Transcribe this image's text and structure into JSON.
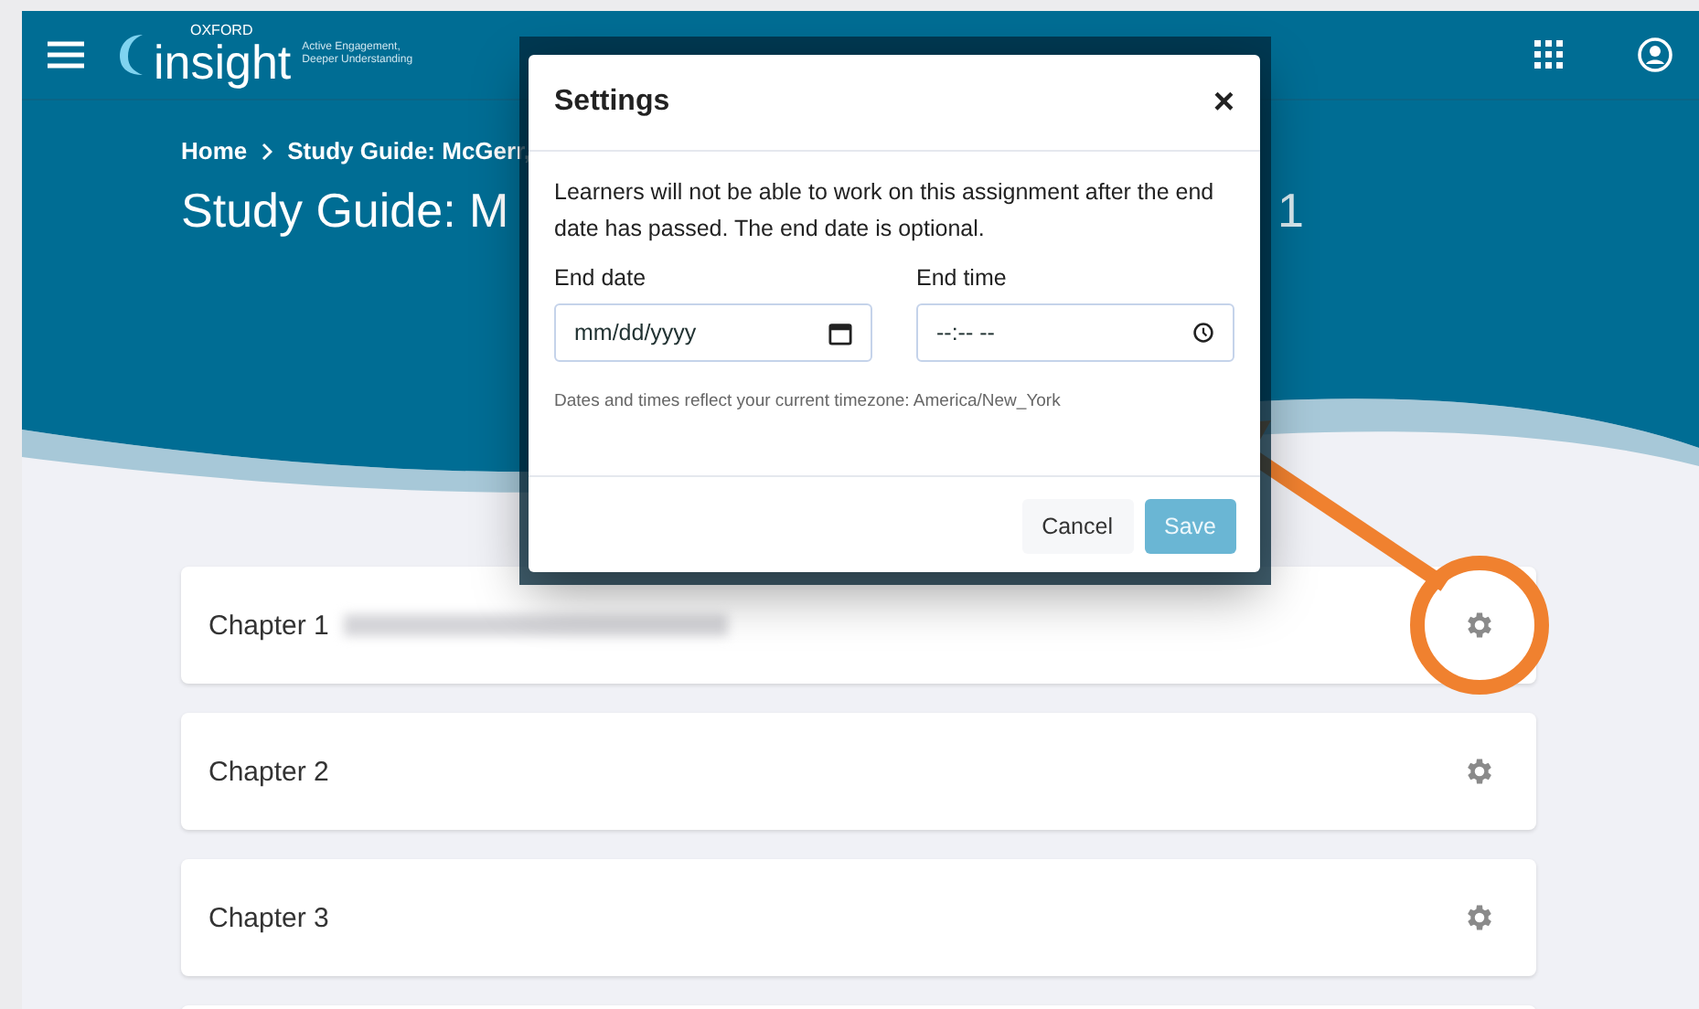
{
  "header": {
    "brand_small": "OXFORD",
    "brand": "insight",
    "tagline": "Active Engagement, Deeper Understanding"
  },
  "breadcrumb": [
    "Home",
    "Study Guide: McGerr,"
  ],
  "hero": {
    "title": "Study Guide: M",
    "title_end": "1"
  },
  "chapters": [
    {
      "title": "Chapter 1",
      "redacted": true,
      "highlighted": true
    },
    {
      "title": "Chapter 2",
      "redacted": false,
      "highlighted": false
    },
    {
      "title": "Chapter 3",
      "redacted": false,
      "highlighted": false
    }
  ],
  "modal": {
    "title": "Settings",
    "close": "×",
    "message": "Learners will not be able to work on this assignment after the end date has passed. The end date is optional.",
    "fields": [
      {
        "label": "End date",
        "placeholder": "mm/dd/yyyy",
        "kind": "date"
      },
      {
        "label": "End time",
        "placeholder": "--:-- --",
        "kind": "time"
      }
    ],
    "note": "Dates and times reflect your current timezone: America/New_York",
    "buttons": [
      {
        "label": "Cancel",
        "kind": "secondary",
        "disabled": false
      },
      {
        "label": "Save",
        "kind": "primary",
        "disabled": true
      }
    ]
  }
}
